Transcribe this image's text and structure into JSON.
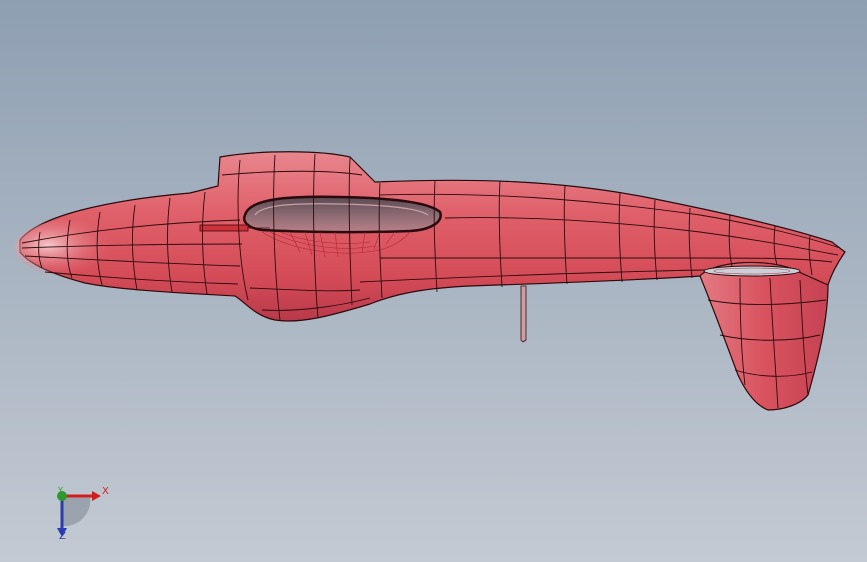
{
  "view": {
    "background_top": "#8e9fb2",
    "background_bottom": "#c3cad3"
  },
  "model": {
    "surface_color": "#d95560",
    "edge_color": "#2a0a0c",
    "cockpit_color": "#7d5f66"
  },
  "triad": {
    "x_label": "X",
    "y_label": "Y",
    "z_label": "Z",
    "x_color": "#d41e1e",
    "y_color": "#2c9a2c",
    "z_color": "#2b3bb0"
  }
}
